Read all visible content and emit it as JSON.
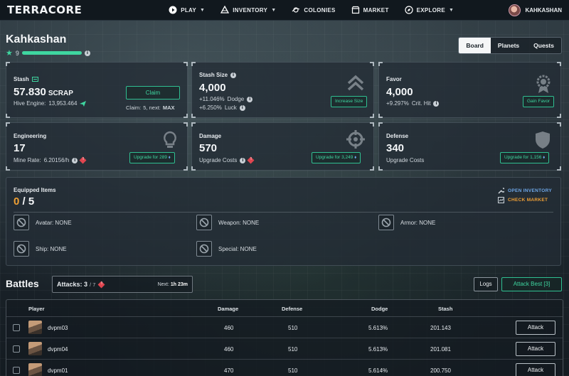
{
  "app": {
    "logo": "TERRACORE"
  },
  "nav": {
    "play": "PLAY",
    "inventory": "INVENTORY",
    "colonies": "COLONIES",
    "market": "MARKET",
    "explore": "EXPLORE",
    "username": "KAHKASHAN"
  },
  "profile": {
    "name": "Kahkashan",
    "level": "9",
    "xp_percent": 100
  },
  "tabs": [
    "Board",
    "Planets",
    "Quests"
  ],
  "stash": {
    "title": "Stash",
    "value": "57.830",
    "unit": "SCRAP",
    "hive_label": "Hive Engine:",
    "hive_value": "13,953.464",
    "claim_label": "Claim",
    "claim_info_label": "Claim:",
    "claim_info_value": "5, next:",
    "claim_info_max": "MAX"
  },
  "stash_size": {
    "title": "Stash Size",
    "value": "4,000",
    "dodge_value": "+11.046%",
    "dodge_label": "Dodge",
    "luck_value": "+6.250%",
    "luck_label": "Luck",
    "button": "Increase Size"
  },
  "favor": {
    "title": "Favor",
    "value": "4,000",
    "crit_value": "+9.297%",
    "crit_label": "Crit. Hit",
    "button": "Gain Favor"
  },
  "engineering": {
    "title": "Engineering",
    "value": "17",
    "sub_label": "Mine Rate:",
    "sub_value": "6.20156/h",
    "button": "Upgrade for 289"
  },
  "damage": {
    "title": "Damage",
    "value": "570",
    "sub_label": "Upgrade Costs",
    "button": "Upgrade for 3,249"
  },
  "defense": {
    "title": "Defense",
    "value": "340",
    "sub_label": "Upgrade Costs",
    "button": "Upgrade for 1,156"
  },
  "equipped": {
    "title": "Equipped Items",
    "current": "0",
    "max": "/ 5",
    "open_inventory": "OPEN INVENTORY",
    "check_market": "CHECK MARKET",
    "slots": {
      "avatar": "Avatar: NONE",
      "weapon": "Weapon: NONE",
      "armor": "Armor: NONE",
      "ship": "Ship: NONE",
      "special": "Special: NONE"
    }
  },
  "battles": {
    "title": "Battles",
    "attacks_label": "Attacks:",
    "attacks_value": "3",
    "attacks_max": "/ 7",
    "next_label": "Next:",
    "next_value": "1h 23m",
    "logs": "Logs",
    "attack_best": "Attack Best [3]",
    "columns": [
      "Player",
      "Damage",
      "Defense",
      "Dodge",
      "Stash"
    ],
    "rows": [
      {
        "player": "dvpm03",
        "damage": "460",
        "defense": "510",
        "dodge": "5.613%",
        "stash": "201.143",
        "action": "Attack"
      },
      {
        "player": "dvpm04",
        "damage": "460",
        "defense": "510",
        "dodge": "5.613%",
        "stash": "201.081",
        "action": "Attack"
      },
      {
        "player": "dvpm01",
        "damage": "470",
        "defense": "510",
        "dodge": "5.614%",
        "stash": "200.750",
        "action": "Attack"
      }
    ]
  },
  "colors": {
    "accent": "#3fd6a0",
    "warning": "#f0a035",
    "link": "#6ea7e8",
    "danger": "#e0454f"
  }
}
